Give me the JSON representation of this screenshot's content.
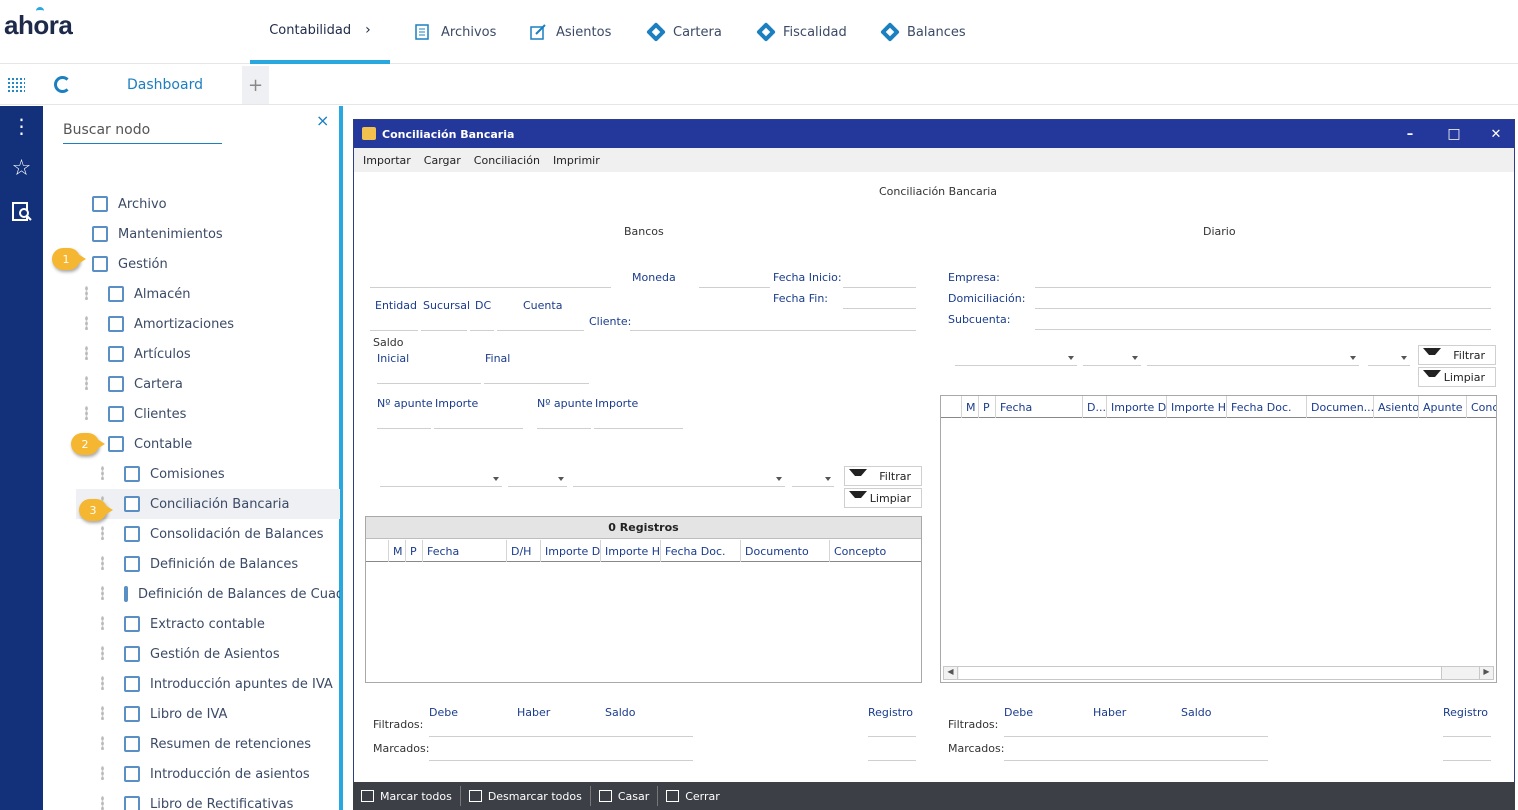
{
  "app": {
    "logo": "ahora"
  },
  "topnav": {
    "items": [
      {
        "label": "Contabilidad",
        "icon": "chevron-right-icon"
      },
      {
        "label": "Archivos",
        "icon": "document-icon"
      },
      {
        "label": "Asientos",
        "icon": "edit-icon"
      },
      {
        "label": "Cartera",
        "icon": "diamond-icon"
      },
      {
        "label": "Fiscalidad",
        "icon": "diamond-icon"
      },
      {
        "label": "Balances",
        "icon": "diamond-icon"
      }
    ],
    "chevron": "›"
  },
  "tabs": {
    "dashboard": "Dashboard",
    "add": "+"
  },
  "tree": {
    "search_placeholder": "Buscar nodo",
    "close": "×",
    "nodes": [
      {
        "label": "Archivo"
      },
      {
        "label": "Mantenimientos"
      },
      {
        "label": "Gestión"
      },
      {
        "label": "Almacén"
      },
      {
        "label": "Amortizaciones"
      },
      {
        "label": "Artículos"
      },
      {
        "label": "Cartera"
      },
      {
        "label": "Clientes"
      },
      {
        "label": "Contable"
      },
      {
        "label": "Comisiones"
      },
      {
        "label": "Conciliación Bancaria"
      },
      {
        "label": "Consolidación de Balances"
      },
      {
        "label": "Definición de Balances"
      },
      {
        "label": "Definición de Balances de Cuadro"
      },
      {
        "label": "Extracto contable"
      },
      {
        "label": "Gestión de Asientos"
      },
      {
        "label": "Introducción apuntes de IVA"
      },
      {
        "label": "Libro de IVA"
      },
      {
        "label": "Resumen de retenciones"
      },
      {
        "label": "Introducción de asientos"
      },
      {
        "label": "Libro de Rectificativas"
      }
    ],
    "badges": [
      "1",
      "2",
      "3"
    ]
  },
  "dialog": {
    "title": "Conciliación Bancaria",
    "controls": {
      "minimize": "–",
      "maximize": "□",
      "close": "✕"
    },
    "menu": [
      "Importar",
      "Cargar",
      "Conciliación",
      "Imprimir"
    ],
    "header": "Conciliación Bancaria",
    "bancos": {
      "section": "Bancos",
      "moneda": "Moneda",
      "fecha_inicio": "Fecha Inicio:",
      "fecha_fin": "Fecha Fin:",
      "entidad": "Entidad",
      "sucursal": "Sucursal",
      "dc": "DC",
      "cuenta": "Cuenta",
      "cliente": "Cliente:",
      "saldo": "Saldo",
      "inicial": "Inicial",
      "final": "Final",
      "napunte1": "Nº apunte",
      "importe1": "Importe",
      "napunte2": "Nº apunte",
      "importe2": "Importe",
      "filtrar": "Filtrar",
      "limpiar": "Limpiar",
      "registros": "0 Registros",
      "columns": [
        "M",
        "P",
        "Fecha",
        "D/H",
        "Importe D",
        "Importe H",
        "Fecha Doc.",
        "Documento",
        "Concepto"
      ],
      "debe": "Debe",
      "haber": "Haber",
      "saldo_f": "Saldo",
      "registro": "Registro",
      "filtrados": "Filtrados:",
      "marcados": "Marcados:"
    },
    "diario": {
      "section": "Diario",
      "empresa": "Empresa:",
      "domiciliacion": "Domiciliación:",
      "subcuenta": "Subcuenta:",
      "filtrar": "Filtrar",
      "limpiar": "Limpiar",
      "columns": [
        "M",
        "P",
        "Fecha",
        "D...",
        "Importe D",
        "Importe H",
        "Fecha Doc.",
        "Documen...",
        "Asiento",
        "Apunte",
        "Conc"
      ],
      "debe": "Debe",
      "haber": "Haber",
      "saldo_f": "Saldo",
      "registro": "Registro",
      "filtrados": "Filtrados:",
      "marcados": "Marcados:"
    },
    "footer": [
      "Marcar todos",
      "Desmarcar todos",
      "Casar",
      "Cerrar"
    ]
  }
}
